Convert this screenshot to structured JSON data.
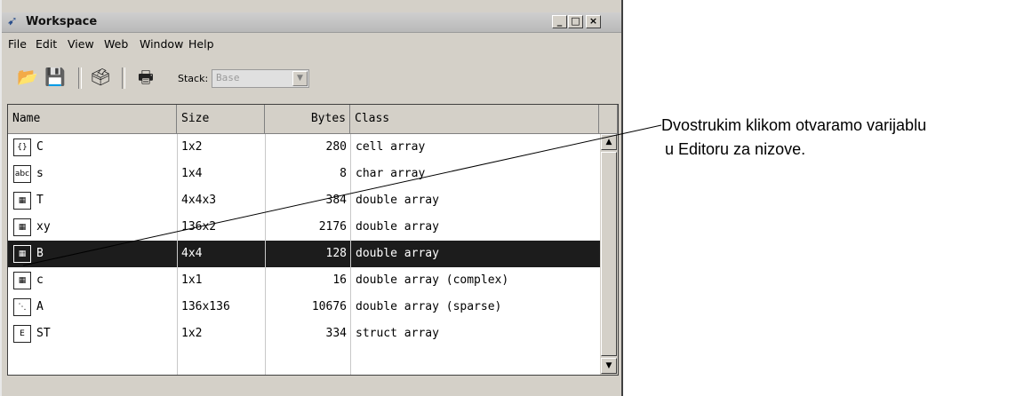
{
  "window": {
    "title": "Workspace",
    "controls": [
      "_",
      "□",
      "×"
    ]
  },
  "menu": [
    "File",
    "Edit",
    "View",
    "Web",
    "Window",
    "Help"
  ],
  "toolbar": {
    "icons": [
      "open-icon",
      "save-icon",
      "import-data-icon",
      "print-icon"
    ],
    "stack_label": "Stack:",
    "stack_value": "Base"
  },
  "table": {
    "columns": [
      "Name",
      "Size",
      "Bytes",
      "Class"
    ],
    "rows": [
      {
        "icon": "cell-array-icon",
        "glyph": "{}",
        "name": "C",
        "size": "1x2",
        "bytes": "280",
        "class": "cell array",
        "selected": false
      },
      {
        "icon": "char-array-icon",
        "glyph": "abc",
        "name": "s",
        "size": "1x4",
        "bytes": "8",
        "class": "char array",
        "selected": false
      },
      {
        "icon": "numeric-array-icon",
        "glyph": "▦",
        "name": "T",
        "size": "4x4x3",
        "bytes": "384",
        "class": "double array",
        "selected": false
      },
      {
        "icon": "numeric-array-icon",
        "glyph": "▦",
        "name": "xy",
        "size": "136x2",
        "bytes": "2176",
        "class": "double array",
        "selected": false
      },
      {
        "icon": "numeric-array-icon",
        "glyph": "▦",
        "name": "B",
        "size": "4x4",
        "bytes": "128",
        "class": "double array",
        "selected": true
      },
      {
        "icon": "numeric-array-icon",
        "glyph": "▦",
        "name": "c",
        "size": "1x1",
        "bytes": "16",
        "class": "double array (complex)",
        "selected": false
      },
      {
        "icon": "sparse-array-icon",
        "glyph": "⋱",
        "name": "A",
        "size": "136x136",
        "bytes": "10676",
        "class": "double array (sparse)",
        "selected": false
      },
      {
        "icon": "struct-array-icon",
        "glyph": "E",
        "name": "ST",
        "size": "1x2",
        "bytes": "334",
        "class": "struct array",
        "selected": false
      }
    ]
  },
  "annotation": {
    "line1": "Dvostrukim klikom otvaramo varijablu",
    "line2": "u Editoru za nizove."
  }
}
